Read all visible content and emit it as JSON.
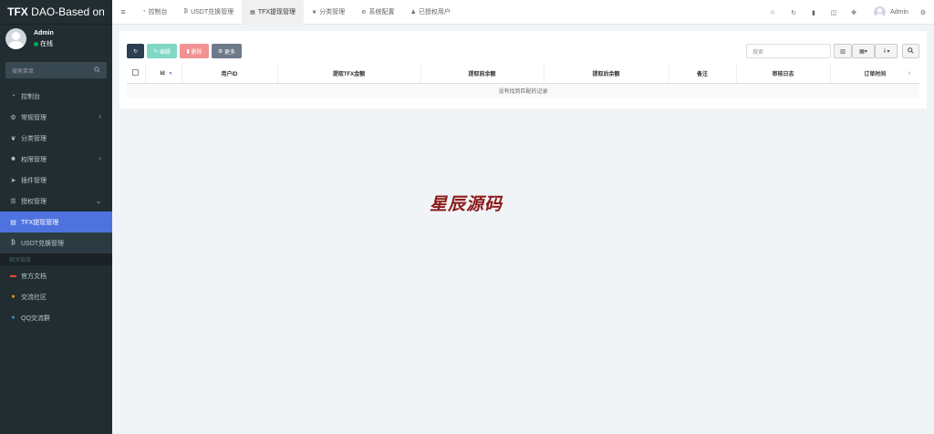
{
  "app": {
    "logo_bold": "TFX",
    "logo_rest": " DAO-Based on"
  },
  "user": {
    "name": "Admin",
    "status": "在线"
  },
  "search": {
    "placeholder": "搜索菜单"
  },
  "sidebar": {
    "items": [
      {
        "label": "控制台",
        "icon": "dashboard-icon"
      },
      {
        "label": "常规管理",
        "icon": "cogs-icon",
        "arrow": "‹"
      },
      {
        "label": "分类管理",
        "icon": "leaf-icon"
      },
      {
        "label": "权限管理",
        "icon": "group-icon",
        "arrow": "‹"
      },
      {
        "label": "插件管理",
        "icon": "rocket-icon"
      },
      {
        "label": "授权管理",
        "icon": "list-icon",
        "arrow": "⌄"
      },
      {
        "label": "TFX提现管理",
        "icon": "card-icon"
      },
      {
        "label": "USDT兑换管理",
        "icon": "bitcoin-icon"
      }
    ],
    "section_header": "相关链接",
    "links": [
      {
        "label": "官方文档",
        "color": "#dd4b39"
      },
      {
        "label": "交流社区",
        "color": "#f39c12"
      },
      {
        "label": "QQ交流群",
        "color": "#3c8dbc"
      }
    ]
  },
  "topbar": {
    "tabs": [
      {
        "label": "控制台"
      },
      {
        "label": "USDT兑换管理"
      },
      {
        "label": "TFX提现管理"
      },
      {
        "label": "分类管理"
      },
      {
        "label": "系统配置"
      },
      {
        "label": "已授权用户"
      }
    ],
    "admin_label": "Admin"
  },
  "toolbar": {
    "edit_label": "编辑",
    "delete_label": "删除",
    "more_label": "更多",
    "search_placeholder": "搜索"
  },
  "table": {
    "columns": [
      "Id",
      "用户ID",
      "提取TFX金额",
      "提取前余额",
      "提取后余额",
      "备注",
      "审核日志",
      "订单时间"
    ],
    "empty_text": "没有找到匹配的记录"
  },
  "watermark": "星辰源码",
  "colors": {
    "sidebar_bg": "#222d32",
    "active_item": "#4e73df",
    "online": "#00a65a"
  }
}
